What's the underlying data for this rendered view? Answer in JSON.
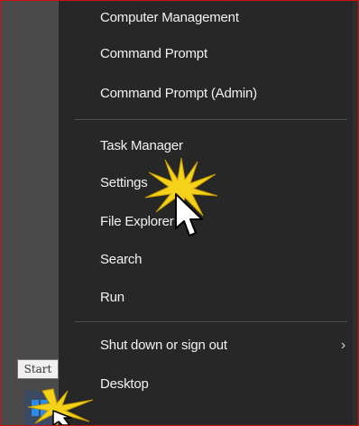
{
  "context_menu": {
    "items": [
      {
        "label": "Computer Management"
      },
      {
        "label": "Command Prompt"
      },
      {
        "label": "Command Prompt (Admin)"
      },
      {
        "label": "Task Manager"
      },
      {
        "label": "Settings"
      },
      {
        "label": "File Explorer"
      },
      {
        "label": "Search"
      },
      {
        "label": "Run"
      },
      {
        "label": "Shut down or sign out",
        "submenu_icon": "chevron-right-icon",
        "submenu_glyph": "›"
      },
      {
        "label": "Desktop"
      }
    ]
  },
  "tooltip": {
    "text": "Start"
  },
  "taskbar": {
    "start_icon": "windows-logo-icon"
  },
  "colors": {
    "menu_background": "#272727",
    "menu_text": "#f2f2f2",
    "divider": "#4d4d4d",
    "frame_border": "#d01010",
    "highlight_flash": "#f4d21a"
  }
}
